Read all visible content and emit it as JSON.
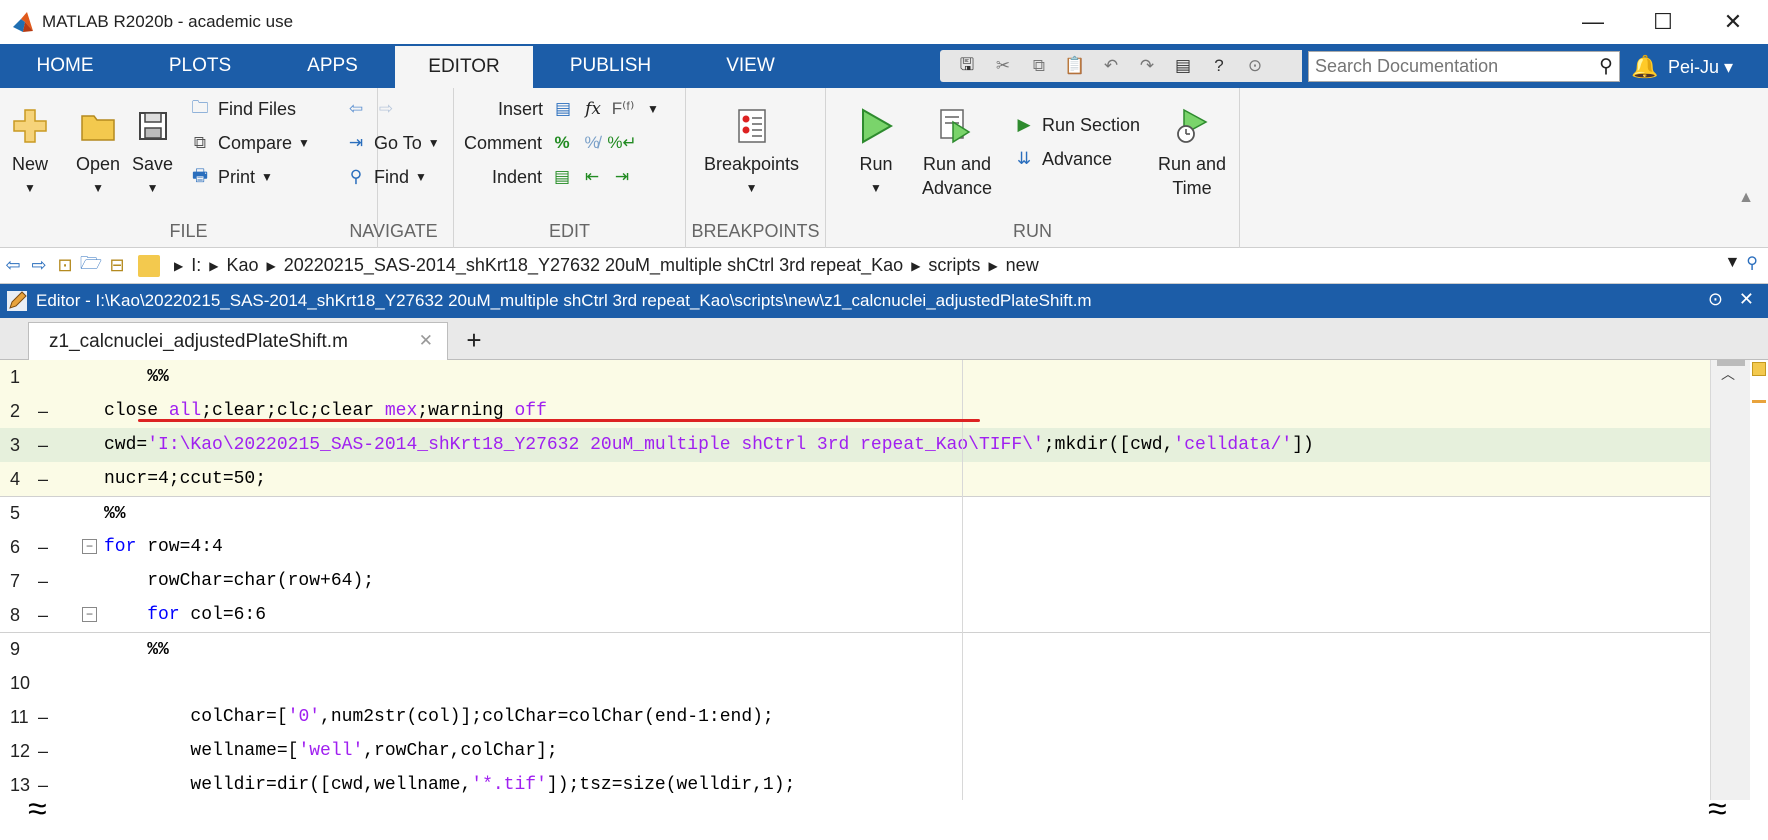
{
  "window": {
    "title": "MATLAB R2020b - academic use",
    "minimize": "—",
    "maximize": "☐",
    "close": "✕"
  },
  "tabs": [
    {
      "label": "HOME",
      "active": false
    },
    {
      "label": "PLOTS",
      "active": false
    },
    {
      "label": "APPS",
      "active": false
    },
    {
      "label": "EDITOR",
      "active": true
    },
    {
      "label": "PUBLISH",
      "active": false
    },
    {
      "label": "VIEW",
      "active": false
    }
  ],
  "search": {
    "placeholder": "Search Documentation"
  },
  "user": {
    "name": "Pei-Ju ▾"
  },
  "toolstrip": {
    "file": {
      "section": "FILE",
      "new": "New",
      "open": "Open",
      "save": "Save",
      "find_files": "Find Files",
      "compare": "Compare",
      "print": "Print"
    },
    "navigate": {
      "section": "NAVIGATE",
      "go_to": "Go To",
      "find": "Find"
    },
    "edit": {
      "section": "EDIT",
      "insert": "Insert",
      "comment": "Comment",
      "indent": "Indent"
    },
    "breakpoints": {
      "section": "BREAKPOINTS",
      "label": "Breakpoints"
    },
    "run": {
      "section": "RUN",
      "run": "Run",
      "run_and_advance_1": "Run and",
      "run_and_advance_2": "Advance",
      "run_section": "Run Section",
      "advance": "Advance",
      "run_and_time_1": "Run and",
      "run_and_time_2": "Time"
    }
  },
  "address": {
    "crumbs": [
      "I:",
      "Kao",
      "20220215_SAS-2014_shKrt18_Y27632 20uM_multiple shCtrl 3rd repeat_Kao",
      "scripts",
      "new"
    ]
  },
  "editor": {
    "title": "Editor - I:\\Kao\\20220215_SAS-2014_shKrt18_Y27632 20uM_multiple shCtrl 3rd repeat_Kao\\scripts\\new\\z1_calcnuclei_adjustedPlateShift.m",
    "tab_name": "z1_calcnuclei_adjustedPlateShift.m",
    "lines": [
      {
        "num": "1",
        "dash": "",
        "text": "    %%"
      },
      {
        "num": "2",
        "dash": "–",
        "text": "close all;clear;clc;clear mex;warning off"
      },
      {
        "num": "3",
        "dash": "–",
        "text": "cwd='I:\\Kao\\20220215_SAS-2014_shKrt18_Y27632 20uM_multiple shCtrl 3rd repeat_Kao\\TIFF\\';mkdir([cwd,'celldata/'])"
      },
      {
        "num": "4",
        "dash": "–",
        "text": "nucr=4;ccut=50;"
      },
      {
        "num": "5",
        "dash": "",
        "text": "%%"
      },
      {
        "num": "6",
        "dash": "–",
        "text": "for row=4:4"
      },
      {
        "num": "7",
        "dash": "–",
        "text": "    rowChar=char(row+64);"
      },
      {
        "num": "8",
        "dash": "–",
        "text": "    for col=6:6"
      },
      {
        "num": "9",
        "dash": "",
        "text": "    %%"
      },
      {
        "num": "10",
        "dash": "",
        "text": ""
      },
      {
        "num": "11",
        "dash": "–",
        "text": "        colChar=['0',num2str(col)];colChar=colChar(end-1:end);"
      },
      {
        "num": "12",
        "dash": "–",
        "text": "        wellname=['well',rowChar,colChar];"
      },
      {
        "num": "13",
        "dash": "–",
        "text": "        welldir=dir([cwd,wellname,'*.tif']);tsz=size(welldir,1);"
      }
    ]
  }
}
